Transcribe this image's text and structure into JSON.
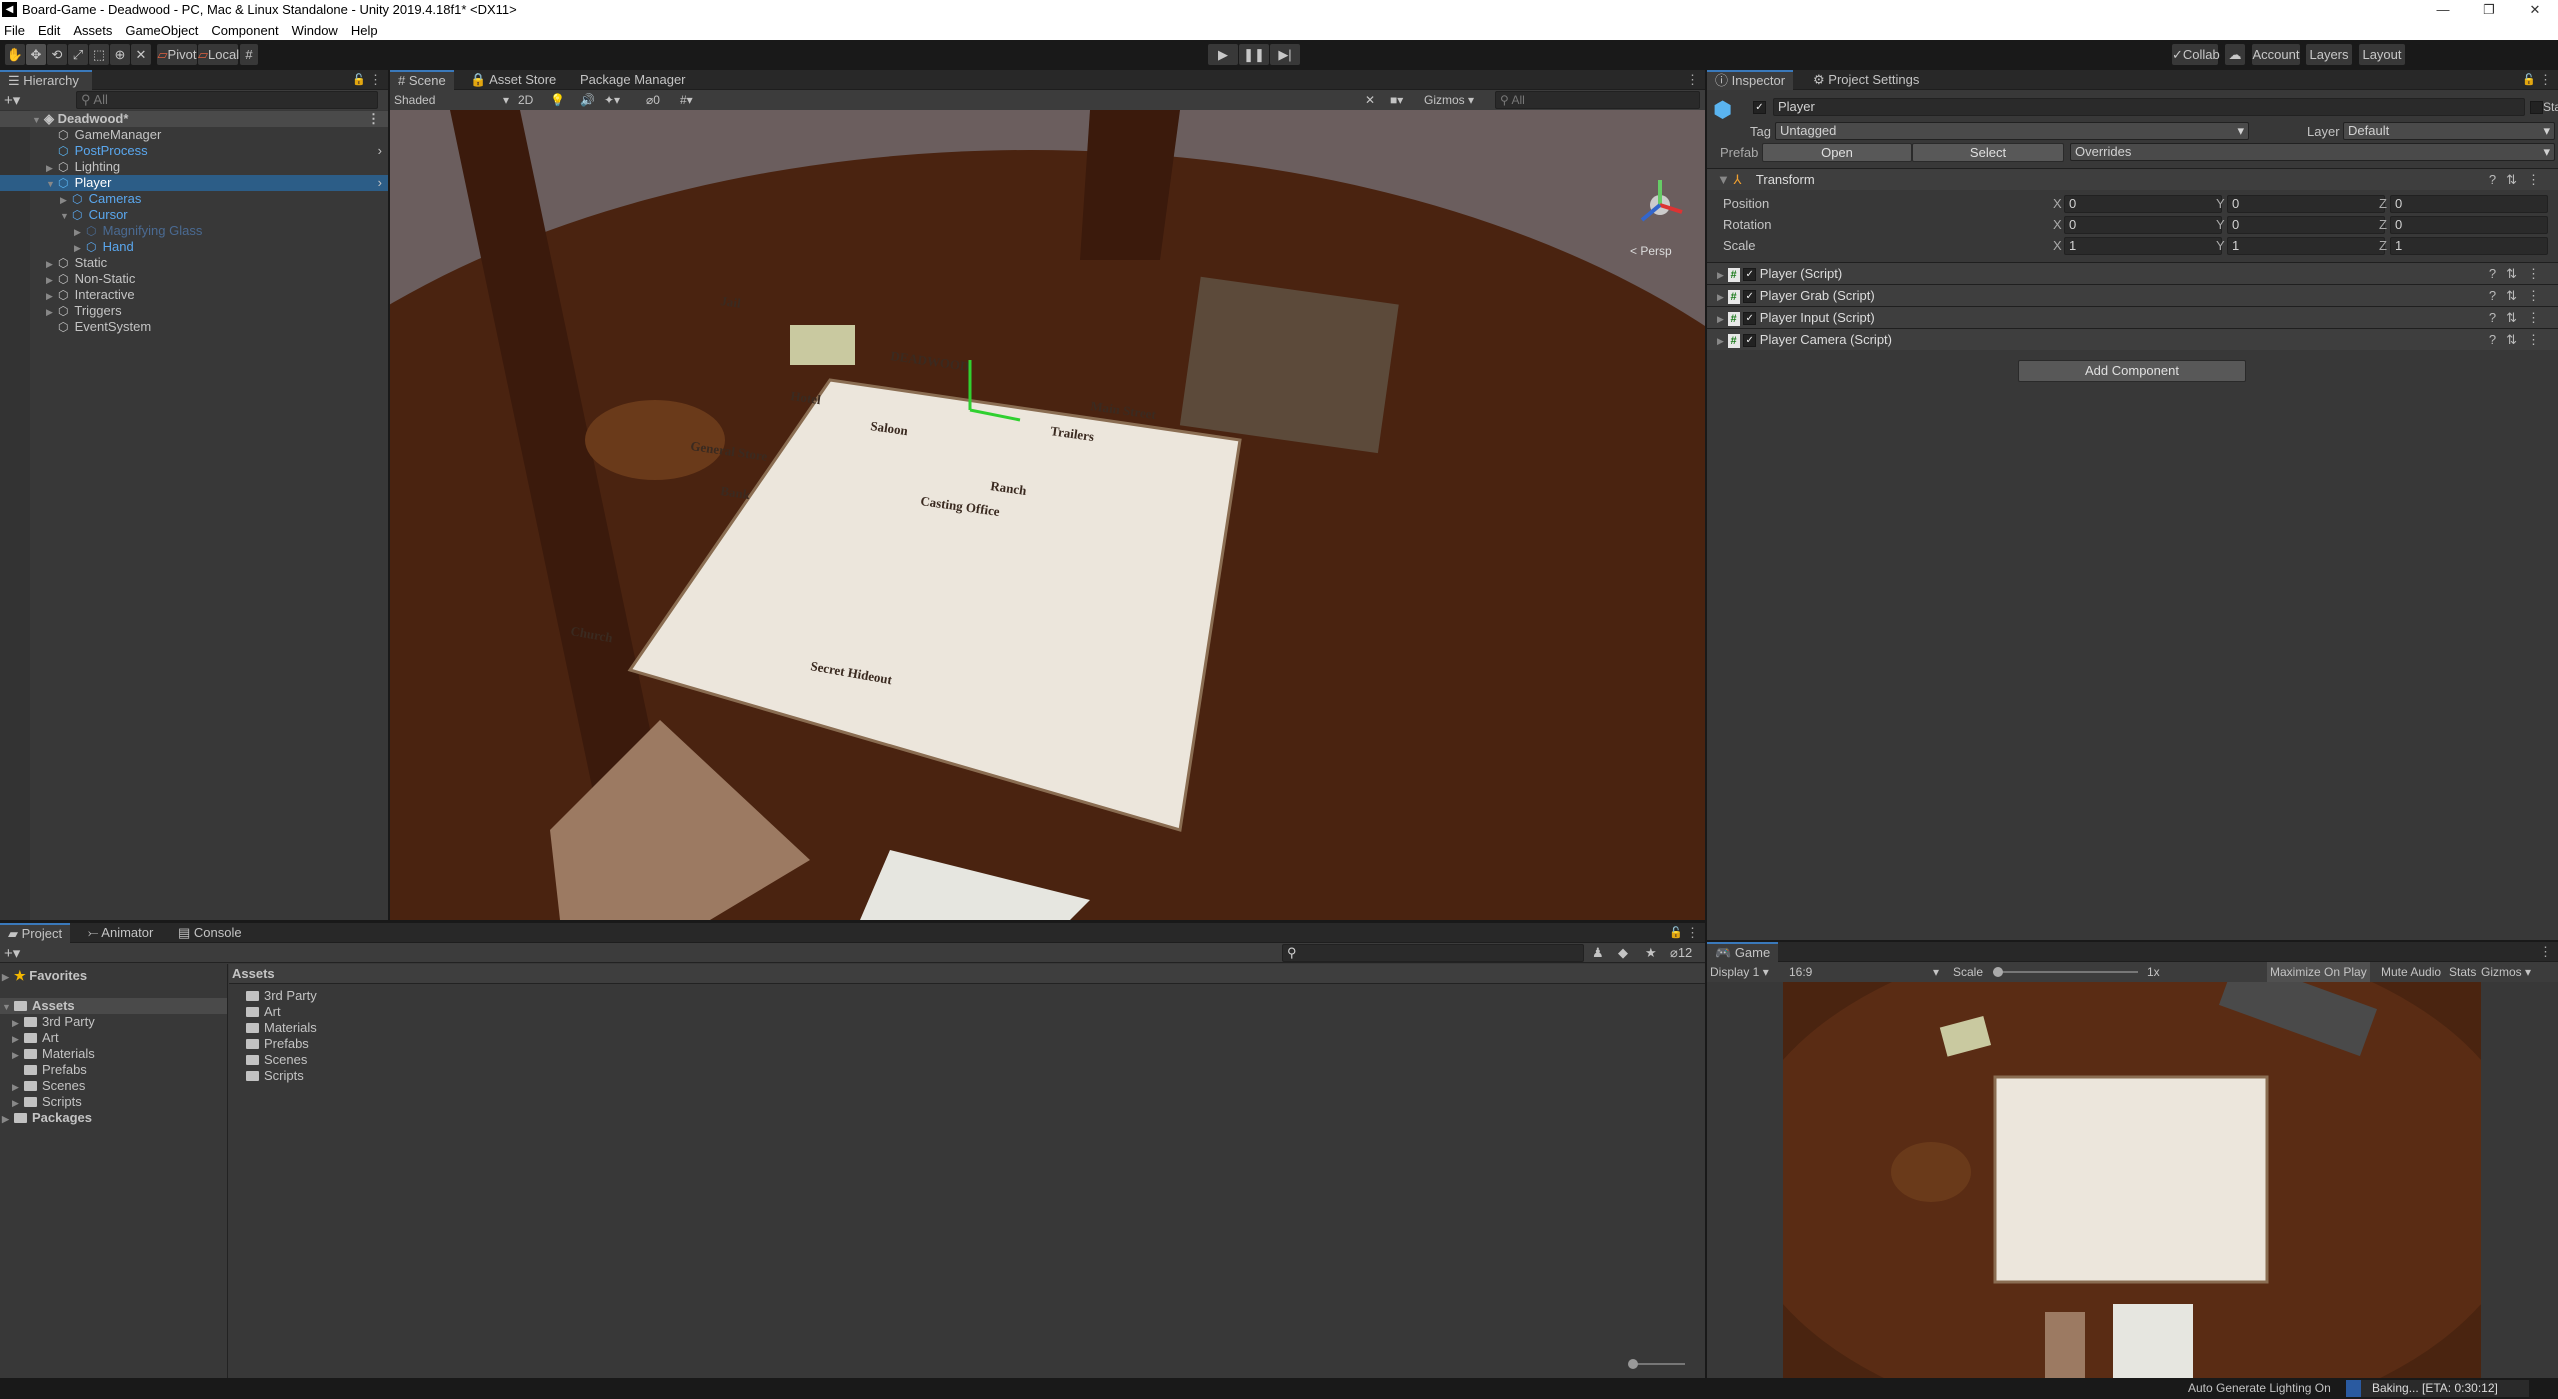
{
  "window": {
    "title": "Board-Game - Deadwood - PC, Mac & Linux Standalone - Unity 2019.4.18f1* <DX11>",
    "controls": [
      "—",
      "❐",
      "✕"
    ]
  },
  "menu": [
    "File",
    "Edit",
    "Assets",
    "GameObject",
    "Component",
    "Window",
    "Help"
  ],
  "toolbar": {
    "tools": [
      "hand-tool",
      "move-tool",
      "rotate-tool",
      "scale-tool",
      "rect-tool",
      "transform-tool",
      "custom-tool"
    ],
    "pivot": "Pivot",
    "local": "Local",
    "collab": "Collab",
    "account": "Account",
    "layers": "Layers",
    "layout": "Layout"
  },
  "hierarchy": {
    "tab": "Hierarchy",
    "search_placeholder": "All",
    "scene": "Deadwood*",
    "items": [
      {
        "label": "GameManager",
        "depth": 1,
        "arrow": "",
        "color": "#c4c4c4"
      },
      {
        "label": "PostProcess",
        "depth": 1,
        "arrow": "",
        "color": "#5aa7ee",
        "prefab": true
      },
      {
        "label": "Lighting",
        "depth": 1,
        "arrow": "▶",
        "color": "#c4c4c4"
      },
      {
        "label": "Player",
        "depth": 1,
        "arrow": "▼",
        "color": "#ffffff",
        "prefab": true,
        "selected": true
      },
      {
        "label": "Cameras",
        "depth": 2,
        "arrow": "▶",
        "color": "#5aa7ee"
      },
      {
        "label": "Cursor",
        "depth": 2,
        "arrow": "▼",
        "color": "#5aa7ee"
      },
      {
        "label": "Magnifying Glass",
        "depth": 3,
        "arrow": "▶",
        "color": "#4a6a92"
      },
      {
        "label": "Hand",
        "depth": 3,
        "arrow": "▶",
        "color": "#5aa7ee"
      },
      {
        "label": "Static",
        "depth": 1,
        "arrow": "▶",
        "color": "#c4c4c4"
      },
      {
        "label": "Non-Static",
        "depth": 1,
        "arrow": "▶",
        "color": "#c4c4c4"
      },
      {
        "label": "Interactive",
        "depth": 1,
        "arrow": "▶",
        "color": "#c4c4c4"
      },
      {
        "label": "Triggers",
        "depth": 1,
        "arrow": "▶",
        "color": "#c4c4c4"
      },
      {
        "label": "EventSystem",
        "depth": 1,
        "arrow": "",
        "color": "#c4c4c4"
      }
    ]
  },
  "scene": {
    "tabs": [
      "Scene",
      "Asset Store",
      "Package Manager"
    ],
    "shading": "Shaded",
    "mode_2d": "2D",
    "hidden_count": "0",
    "gizmos": "Gizmos",
    "search_placeholder": "All",
    "persp": "< Persp",
    "board_labels": [
      "DEADWOOD",
      "Main Street",
      "Trailers",
      "Saloon",
      "Jail",
      "General Store",
      "Bank",
      "Casting Office",
      "Hotel",
      "Ranch",
      "Church",
      "Secret Hideout"
    ]
  },
  "inspector": {
    "tabs": [
      "Inspector",
      "Project Settings"
    ],
    "object_name": "Player",
    "active": true,
    "static_label": "Static",
    "tag_label": "Tag",
    "tag": "Untagged",
    "layer_label": "Layer",
    "layer": "Default",
    "prefab_label": "Prefab",
    "prefab_open": "Open",
    "prefab_select": "Select",
    "overrides": "Overrides",
    "transform": {
      "title": "Transform",
      "rows": [
        {
          "label": "Position",
          "x": "0",
          "y": "0",
          "z": "0"
        },
        {
          "label": "Rotation",
          "x": "0",
          "y": "0",
          "z": "0"
        },
        {
          "label": "Scale",
          "x": "1",
          "y": "1",
          "z": "1"
        }
      ]
    },
    "components": [
      "Player (Script)",
      "Player Grab (Script)",
      "Player Input (Script)",
      "Player Camera (Script)"
    ],
    "add_component": "Add Component"
  },
  "project": {
    "tabs": [
      "Project",
      "Animator",
      "Console"
    ],
    "favorites": "Favorites",
    "assets": "Assets",
    "packages": "Packages",
    "hidden_count": "12",
    "tree": [
      {
        "label": "3rd Party",
        "arrow": "▶"
      },
      {
        "label": "Art",
        "arrow": "▶"
      },
      {
        "label": "Materials",
        "arrow": "▶"
      },
      {
        "label": "Prefabs",
        "arrow": ""
      },
      {
        "label": "Scenes",
        "arrow": "▶"
      },
      {
        "label": "Scripts",
        "arrow": "▶"
      }
    ],
    "breadcrumb": "Assets",
    "folders": [
      "3rd Party",
      "Art",
      "Materials",
      "Prefabs",
      "Scenes",
      "Scripts"
    ]
  },
  "game": {
    "tab": "Game",
    "display": "Display 1",
    "aspect": "16:9",
    "scale_label": "Scale",
    "scale_value": "1x",
    "maximize": "Maximize On Play",
    "mute": "Mute Audio",
    "stats": "Stats",
    "gizmos": "Gizmos"
  },
  "status": {
    "lighting": "Auto Generate Lighting On",
    "baking": "Baking... [ETA: 0:30:12]",
    "bake_progress": 0.08
  }
}
